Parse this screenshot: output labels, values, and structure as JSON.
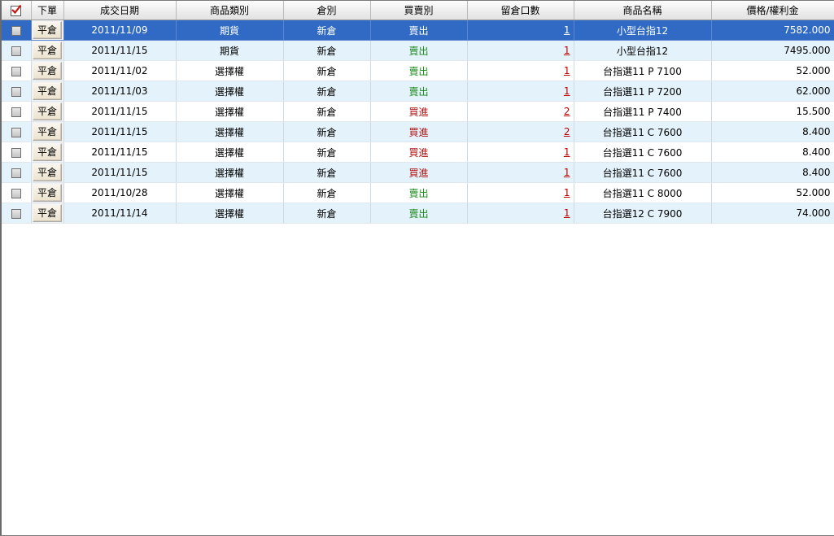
{
  "headers": {
    "check": "",
    "action": "下單",
    "date": "成交日期",
    "category": "商品類別",
    "position": "倉別",
    "side": "買賣別",
    "qty": "留倉口數",
    "product": "商品名稱",
    "price": "價格/權利金"
  },
  "close_label": "平倉",
  "selected_row": 0,
  "colors": {
    "selection": "#316ac5",
    "sell": "#1a8a1a",
    "buy": "#b01010",
    "qty_link": "#c00000",
    "alt_row": "#e4f3fb"
  },
  "rows": [
    {
      "date": "2011/11/09",
      "category": "期貨",
      "position": "新倉",
      "side": "賣出",
      "side_type": "sell",
      "qty": "1",
      "product": "小型台指12",
      "price": "7582.000"
    },
    {
      "date": "2011/11/15",
      "category": "期貨",
      "position": "新倉",
      "side": "賣出",
      "side_type": "sell",
      "qty": "1",
      "product": "小型台指12",
      "price": "7495.000"
    },
    {
      "date": "2011/11/02",
      "category": "選擇權",
      "position": "新倉",
      "side": "賣出",
      "side_type": "sell",
      "qty": "1",
      "product": "台指選11 P 7100",
      "price": "52.000"
    },
    {
      "date": "2011/11/03",
      "category": "選擇權",
      "position": "新倉",
      "side": "賣出",
      "side_type": "sell",
      "qty": "1",
      "product": "台指選11 P 7200",
      "price": "62.000"
    },
    {
      "date": "2011/11/15",
      "category": "選擇權",
      "position": "新倉",
      "side": "買進",
      "side_type": "buy",
      "qty": "2",
      "product": "台指選11 P 7400",
      "price": "15.500"
    },
    {
      "date": "2011/11/15",
      "category": "選擇權",
      "position": "新倉",
      "side": "買進",
      "side_type": "buy",
      "qty": "2",
      "product": "台指選11 C 7600",
      "price": "8.400"
    },
    {
      "date": "2011/11/15",
      "category": "選擇權",
      "position": "新倉",
      "side": "買進",
      "side_type": "buy",
      "qty": "1",
      "product": "台指選11 C 7600",
      "price": "8.400"
    },
    {
      "date": "2011/11/15",
      "category": "選擇權",
      "position": "新倉",
      "side": "買進",
      "side_type": "buy",
      "qty": "1",
      "product": "台指選11 C 7600",
      "price": "8.400"
    },
    {
      "date": "2011/10/28",
      "category": "選擇權",
      "position": "新倉",
      "side": "賣出",
      "side_type": "sell",
      "qty": "1",
      "product": "台指選11 C 8000",
      "price": "52.000"
    },
    {
      "date": "2011/11/14",
      "category": "選擇權",
      "position": "新倉",
      "side": "賣出",
      "side_type": "sell",
      "qty": "1",
      "product": "台指選12 C 7900",
      "price": "74.000"
    }
  ]
}
